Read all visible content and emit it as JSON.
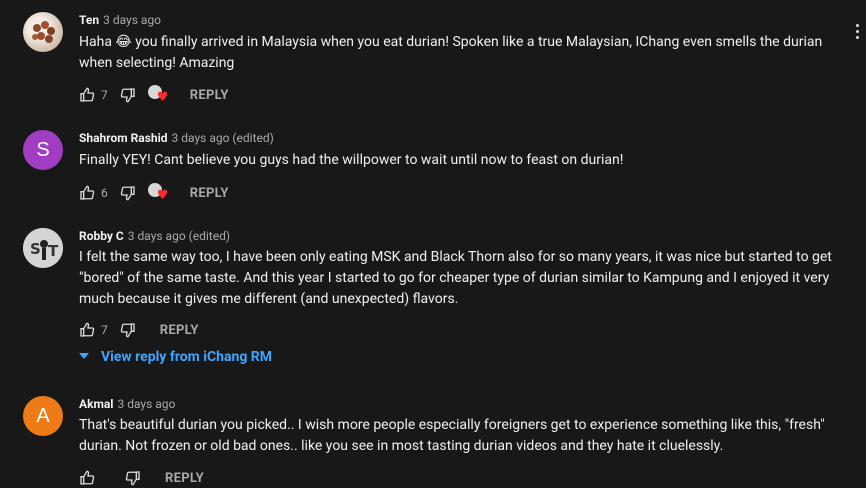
{
  "comments": [
    {
      "author": "Ten",
      "meta": "3 days ago",
      "text": "Haha 😂 you finally arrived in Malaysia when you eat durian! Spoken like a true Malaysian, IChang even smells the durian when selecting! Amazing",
      "likes": "7",
      "reply": "REPLY",
      "avatar_icon": "food-photo-avatar",
      "hearted": true
    },
    {
      "author": "Shahrom Rashid",
      "meta": "3 days ago (edited)",
      "text": "Finally YEY! Cant believe you guys had the willpower to wait until now to feast on durian!",
      "likes": "6",
      "reply": "REPLY",
      "avatar_letter": "S",
      "hearted": true
    },
    {
      "author": "Robby C",
      "meta": "3 days ago (edited)",
      "text": "I felt the same way too, I have been only eating  MSK and Black Thorn also for so many years, it was nice but started to get \"bored\" of the same taste. And this year I started to go for cheaper type of durian similar to Kampung and I enjoyed it very much because it gives me different (and unexpected) flavors.",
      "likes": "7",
      "reply": "REPLY",
      "view_reply": "View reply from iChang RM",
      "hearted": false
    },
    {
      "author": "Akmal",
      "meta": "3 days ago",
      "text": "That's beautiful durian you picked.. I wish more people especially foreigners get to experience something like this, \"fresh\" durian. Not frozen or old bad ones.. like you see in most tasting durian videos and they hate it cluelessly.",
      "reply": "REPLY",
      "avatar_letter": "A",
      "hearted": false
    }
  ],
  "colors": {
    "background": "#181818",
    "link_blue": "#3ea6ff",
    "heart_red": "#ff2a2a"
  }
}
